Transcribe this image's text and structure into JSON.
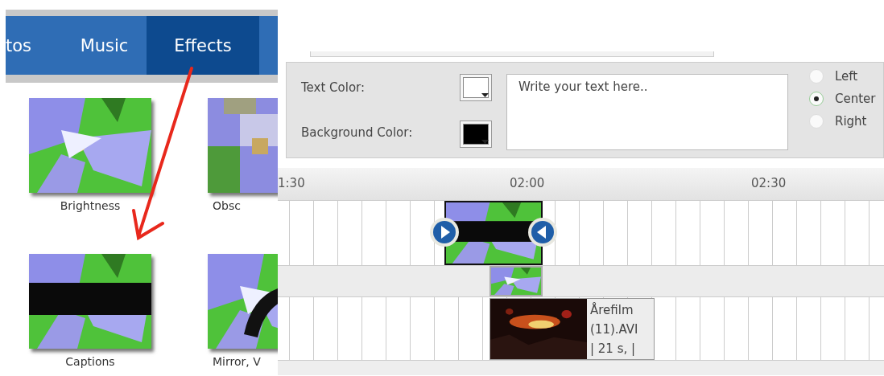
{
  "tabs": [
    {
      "label": "tos",
      "selected": false
    },
    {
      "label": "Music",
      "selected": false
    },
    {
      "label": "Effects",
      "selected": true
    }
  ],
  "effects": [
    {
      "label": "Brightness",
      "kind": "picture"
    },
    {
      "label": "Obsc",
      "kind": "picture"
    },
    {
      "label": "Captions",
      "kind": "picture"
    },
    {
      "label": "Mirror, V",
      "kind": "picture"
    }
  ],
  "caption_editor": {
    "color_pickers": [
      {
        "label": "Text Color:",
        "color": "#ffffff"
      },
      {
        "label": "Background Color:",
        "color": "#000000"
      }
    ],
    "placeholder": "Write your text here..",
    "alignment": [
      {
        "label": "Left",
        "selected": false
      },
      {
        "label": "Center",
        "selected": true
      },
      {
        "label": "Right",
        "selected": false
      }
    ]
  },
  "timeline": {
    "ruler": [
      "1:30",
      "02:00",
      "02:30"
    ],
    "clip_label": [
      "Årefilm",
      "(11).AVI",
      "| 21 s, |"
    ]
  }
}
